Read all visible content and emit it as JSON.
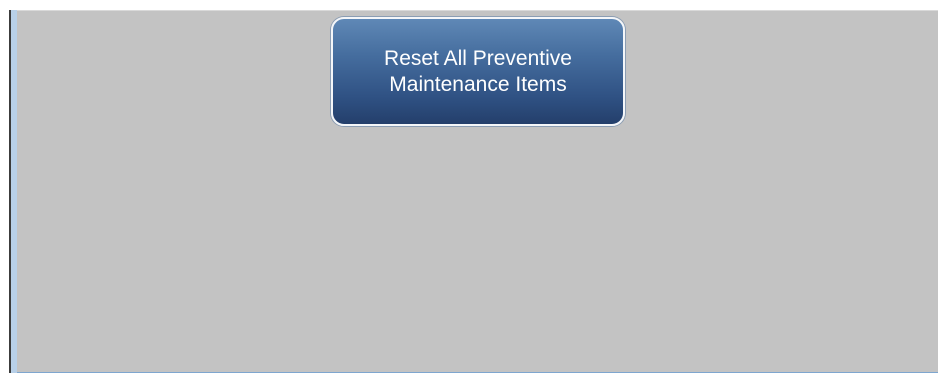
{
  "screen": {
    "background_color": "#c3c3c3",
    "accent_color": "#b8d0e8"
  },
  "reset_button": {
    "label": "Reset All Preventive\nMaintenance Items",
    "gradient_top": "#5f88b6",
    "gradient_bottom": "#243f6b",
    "text_color": "#ffffff"
  }
}
